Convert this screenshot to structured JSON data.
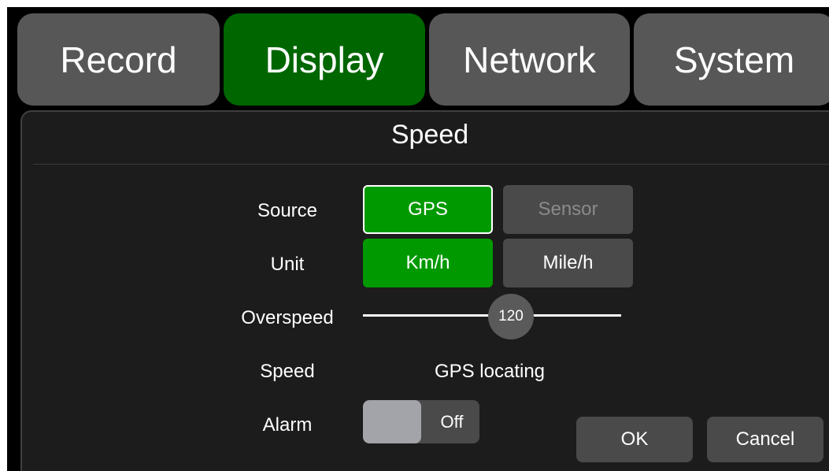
{
  "tabs": [
    {
      "label": "Record",
      "active": false
    },
    {
      "label": "Display",
      "active": true
    },
    {
      "label": "Network",
      "active": false
    },
    {
      "label": "System",
      "active": false
    }
  ],
  "panel": {
    "title": "Speed",
    "source": {
      "label": "Source",
      "options": [
        "GPS",
        "Sensor"
      ],
      "selected": "GPS",
      "disabled_option": "Sensor"
    },
    "unit": {
      "label": "Unit",
      "options": [
        "Km/h",
        "Mile/h"
      ],
      "selected": "Km/h"
    },
    "overspeed": {
      "label": "Overspeed",
      "value": "120"
    },
    "speed": {
      "label": "Speed",
      "value": "GPS locating"
    },
    "alarm": {
      "label": "Alarm",
      "state": "Off"
    },
    "ok_label": "OK",
    "cancel_label": "Cancel"
  },
  "colors": {
    "active_tab": "#006600",
    "selected_button": "#009900",
    "inactive": "#4a4a4a",
    "background": "#000000"
  }
}
